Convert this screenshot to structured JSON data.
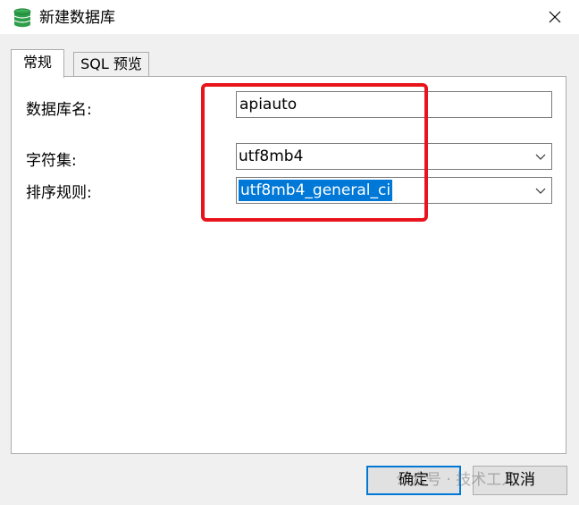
{
  "window": {
    "title": "新建数据库",
    "title_icon": "database-icon",
    "close_icon": "close-icon"
  },
  "tabs": [
    {
      "label": "常规",
      "active": true
    },
    {
      "label": "SQL 预览",
      "active": false
    }
  ],
  "form": {
    "db_name_label": "数据库名:",
    "db_name_value": "apiauto",
    "charset_label": "字符集:",
    "charset_value": "utf8mb4",
    "collation_label": "排序规则:",
    "collation_value": "utf8mb4_general_ci"
  },
  "buttons": {
    "ok_label": "确定",
    "cancel_label": "取消"
  },
  "watermark": "公众号 · 技术工人",
  "colors": {
    "annotation": "#e8141c",
    "accent": "#0078d7",
    "icon": "#2e9e4a"
  }
}
